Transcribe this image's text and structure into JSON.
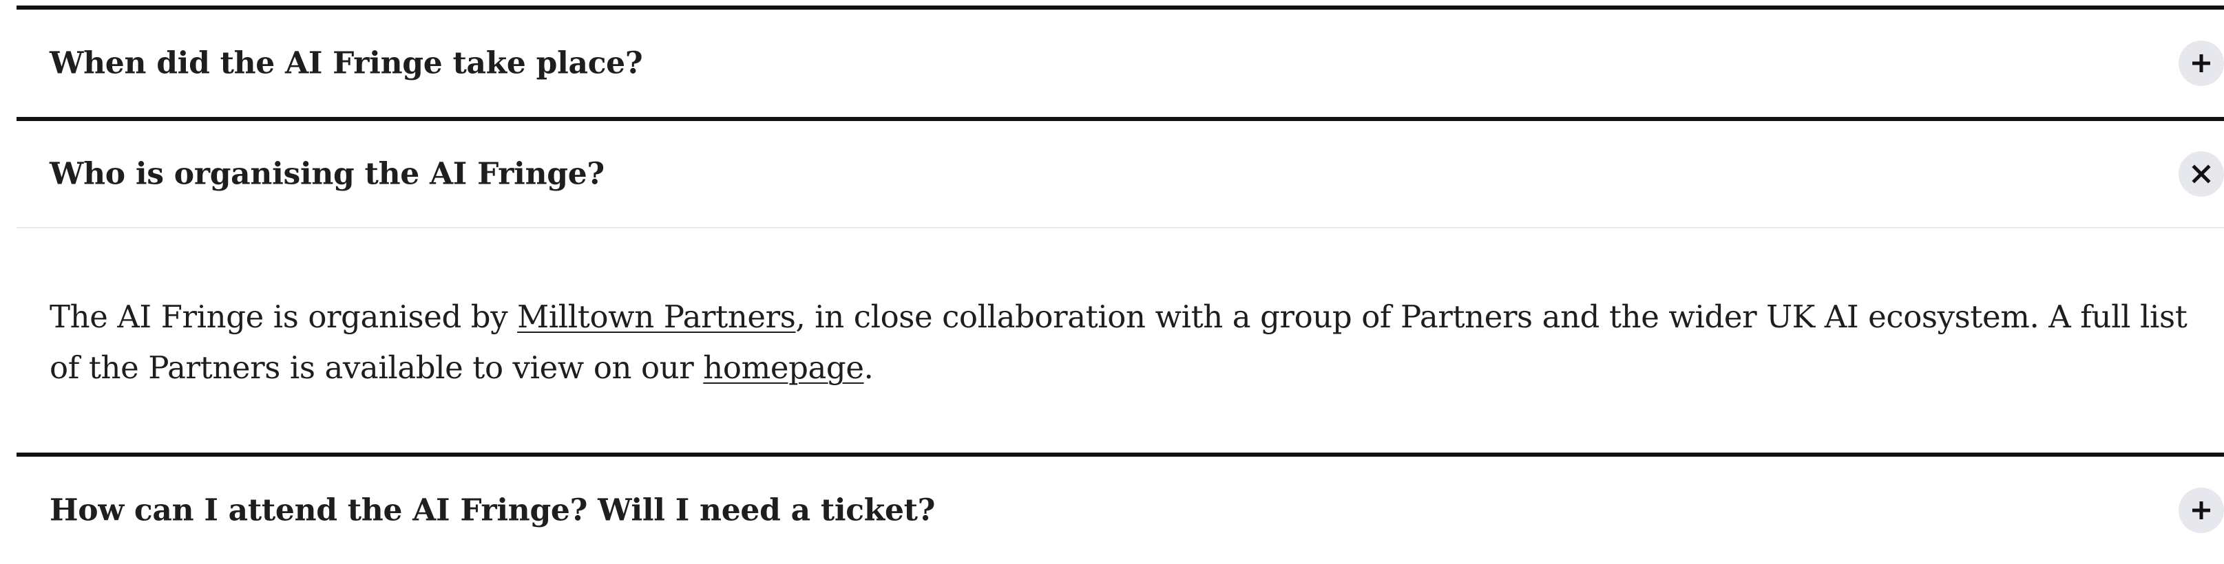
{
  "faq": {
    "items": [
      {
        "question": "When did the AI Fringe take place?",
        "expanded": false,
        "toggle_icon": "plus-icon"
      },
      {
        "question": "Who is organising the AI Fringe?",
        "expanded": true,
        "toggle_icon": "close-icon",
        "answer": {
          "text_1": "The AI Fringe is organised by ",
          "link_1": "Milltown Partners",
          "text_2": ", in close collaboration with a group of Partners and the wider UK AI ecosystem. A full list of the Partners is available to view on our ",
          "link_2": "homepage",
          "text_3": "."
        }
      },
      {
        "question": "How can I attend the AI Fringe? Will I need a ticket?",
        "expanded": false,
        "toggle_icon": "plus-icon"
      }
    ]
  },
  "colors": {
    "divider": "#111111",
    "toggle_background": "#e6e8ee",
    "text": "#1e1e1e"
  }
}
